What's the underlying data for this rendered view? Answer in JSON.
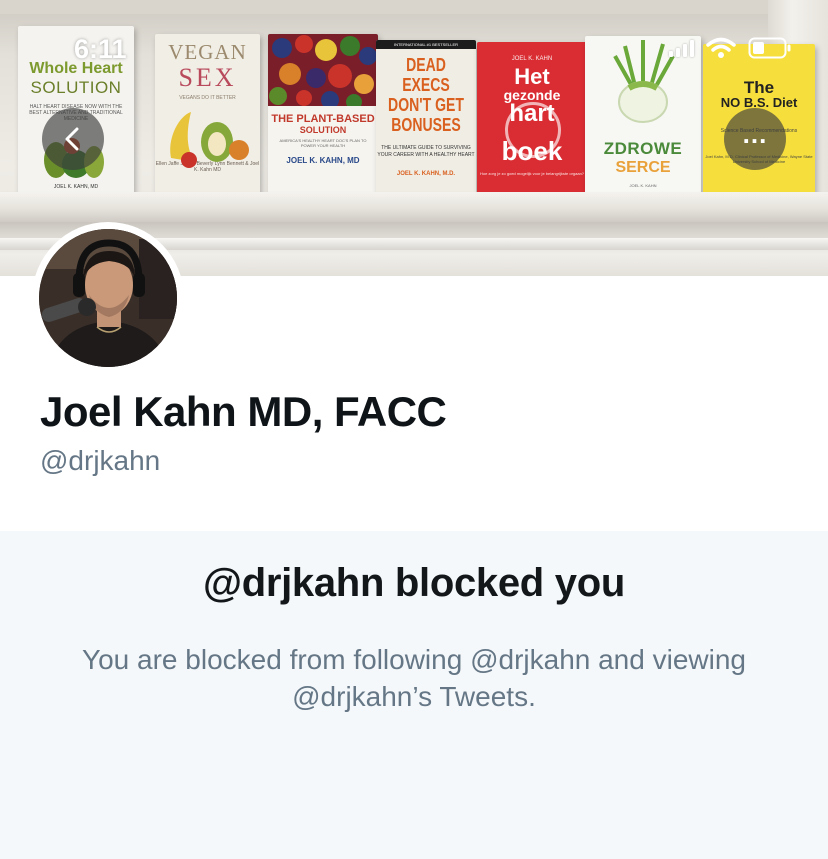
{
  "status_bar": {
    "time": "6:11",
    "icons": [
      "signal-icon",
      "wifi-icon",
      "battery-icon"
    ]
  },
  "header": {
    "back_icon": "chevron-left-icon",
    "more_label": "...",
    "banner_books": [
      {
        "title_line1": "Whole Heart",
        "title_line2": "SOLUTION",
        "subtitle": "HALT HEART DISEASE NOW WITH THE BEST ALTERNATIVE AND TRADITIONAL MEDICINE",
        "author": "JOEL K. KAHN, MD"
      },
      {
        "title_line1": "VEGAN",
        "title_line2": "SEX",
        "subtitle": "VEGANS DO IT BETTER",
        "author": "Ellen Jaffe Jones, Beverly Lynn Bennett & Joel K. Kahn MD"
      },
      {
        "title_line1": "THE PLANT-BASED",
        "title_line2": "SOLUTION",
        "subtitle": "AMERICA'S HEALTHY HEART DOC'S PLAN TO POWER YOUR HEALTH",
        "author": "JOEL K. KAHN, MD"
      },
      {
        "band": "INTERNATIONAL #1 BESTSELLER",
        "title_line1": "DEAD EXECS DON'T GET BONUSES",
        "subtitle": "THE ULTIMATE GUIDE TO SURVIVING YOUR CAREER WITH A HEALTHY HEART",
        "author": "JOEL K. KAHN, M.D."
      },
      {
        "author": "JOEL K. KAHN",
        "title_line1": "Het",
        "title_line2": "gezonde",
        "title_line3": "hart",
        "title_line4": "boek",
        "subtitle": "Hoe zorg je zo goed mogelijk voor je belangrijkste orgaan?"
      },
      {
        "title_line1": "ZDROWE",
        "title_line2": "SERCE",
        "author": "JOEL K. KAHN"
      },
      {
        "title_line1": "The",
        "title_line2": "NO B.S. Diet",
        "subtitle": "Science Based Recommendations",
        "author": "Joel Kahn, M.D. Clinical Professor of Medicine, Wayne State University School of Medicine"
      }
    ]
  },
  "profile": {
    "display_name": "Joel Kahn MD, FACC",
    "handle": "@drjkahn",
    "avatar_icon": "profile-photo"
  },
  "blocked": {
    "title": "@drjkahn blocked you",
    "description": "You are blocked from following @drjkahn and viewing @drjkahn’s Tweets."
  },
  "colors": {
    "text_primary": "#0f1419",
    "text_secondary": "#657786",
    "panel_bg": "#f5f8fa"
  }
}
